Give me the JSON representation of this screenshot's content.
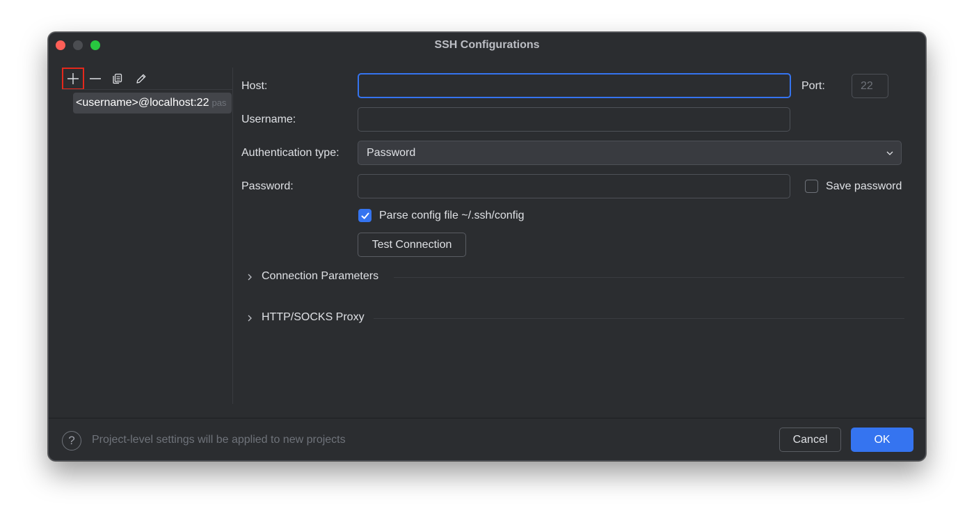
{
  "window": {
    "title": "SSH Configurations"
  },
  "sidebar": {
    "toolbar": {
      "add": "add-icon",
      "remove": "remove-icon",
      "copy": "copy-icon",
      "edit": "edit-icon"
    },
    "items": [
      {
        "label": "<username>@localhost:22",
        "hint": "pas"
      }
    ]
  },
  "form": {
    "host_label": "Host:",
    "host_value": "",
    "port_label": "Port:",
    "port_placeholder": "22",
    "username_label": "Username:",
    "username_value": "",
    "auth_label": "Authentication type:",
    "auth_value": "Password",
    "password_label": "Password:",
    "password_value": "",
    "save_password_label": "Save password",
    "save_password_checked": false,
    "parse_config_label": "Parse config file ~/.ssh/config",
    "parse_config_checked": true,
    "test_connection_label": "Test Connection"
  },
  "sections": [
    {
      "label": "Connection Parameters",
      "expanded": false
    },
    {
      "label": "HTTP/SOCKS Proxy",
      "expanded": false
    }
  ],
  "footer": {
    "help_glyph": "?",
    "info_text": "Project-level settings will be applied to new projects",
    "cancel_label": "Cancel",
    "ok_label": "OK"
  },
  "colors": {
    "background": "#2b2d30",
    "accent": "#3574f0",
    "highlight": "#e5281b"
  }
}
